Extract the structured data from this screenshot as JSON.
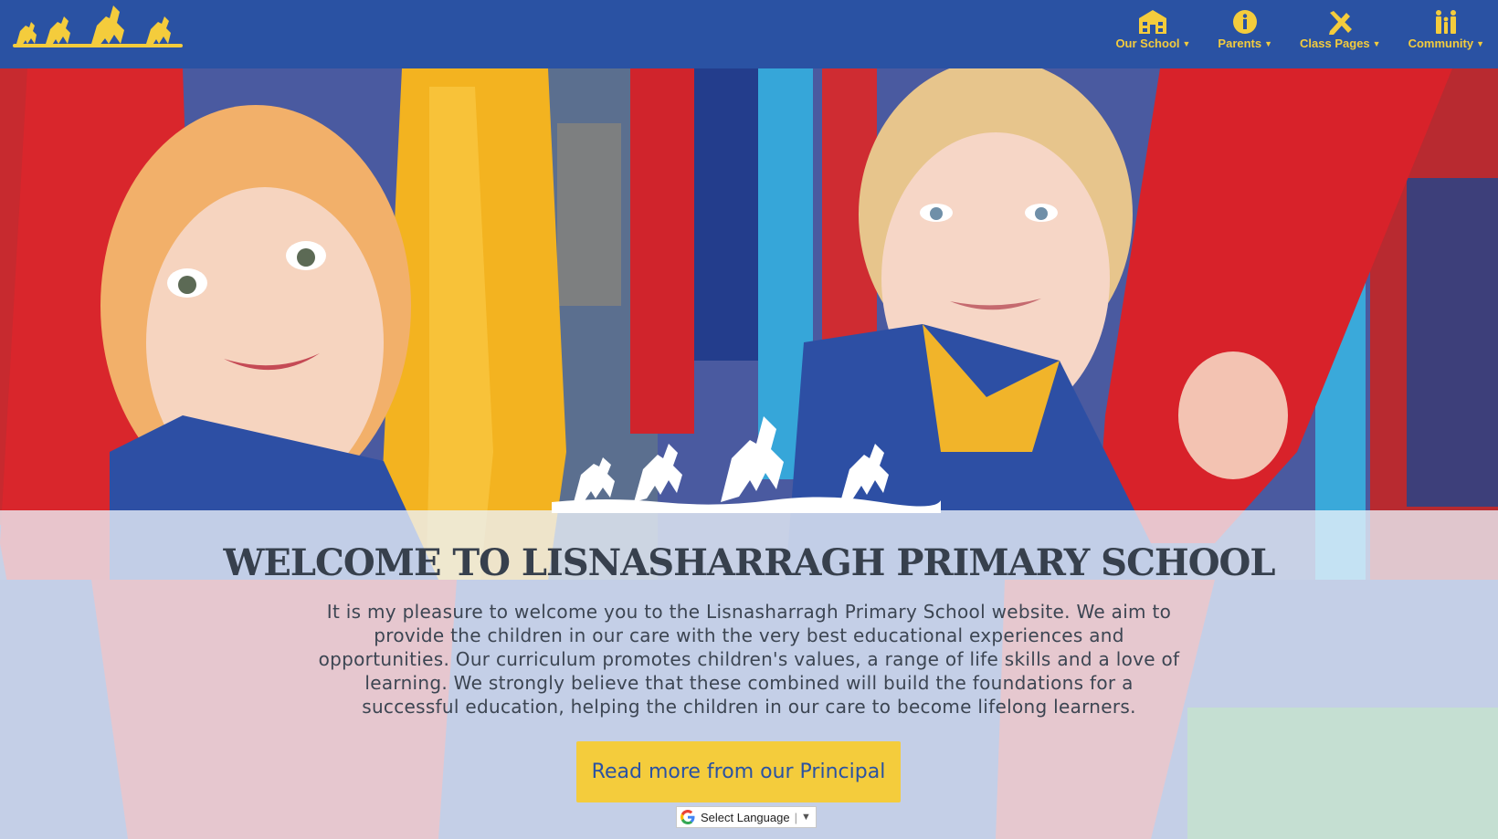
{
  "header": {
    "logo_alt": "Lisnasharragh Primary School horses logo",
    "nav": [
      {
        "label": "Our School",
        "icon": "school-building-icon"
      },
      {
        "label": "Parents",
        "icon": "info-circle-icon"
      },
      {
        "label": "Class Pages",
        "icon": "pencil-ruler-icon"
      },
      {
        "label": "Community",
        "icon": "family-icon"
      }
    ],
    "caret_icon": "caret-down-icon"
  },
  "hero": {
    "title": "WELCOME TO LISNASHARRAGH PRIMARY SCHOOL",
    "intro": "It is my pleasure to welcome you to the Lisnasharragh Primary School website. We aim to provide the children in our care with the very best educational experiences and opportunities. Our curriculum promotes children's values, a range of life skills and a love of learning. We strongly believe that these combined will build the foundations for a successful education, helping the children in our care to become lifelong learners.",
    "cta_label": "Read more from our Principal"
  },
  "translate": {
    "label": "Select Language",
    "arrow": "▼"
  },
  "colors": {
    "header_bg": "#2a52a3",
    "accent_yellow": "#f4cc3c",
    "title_text": "#37404d"
  }
}
